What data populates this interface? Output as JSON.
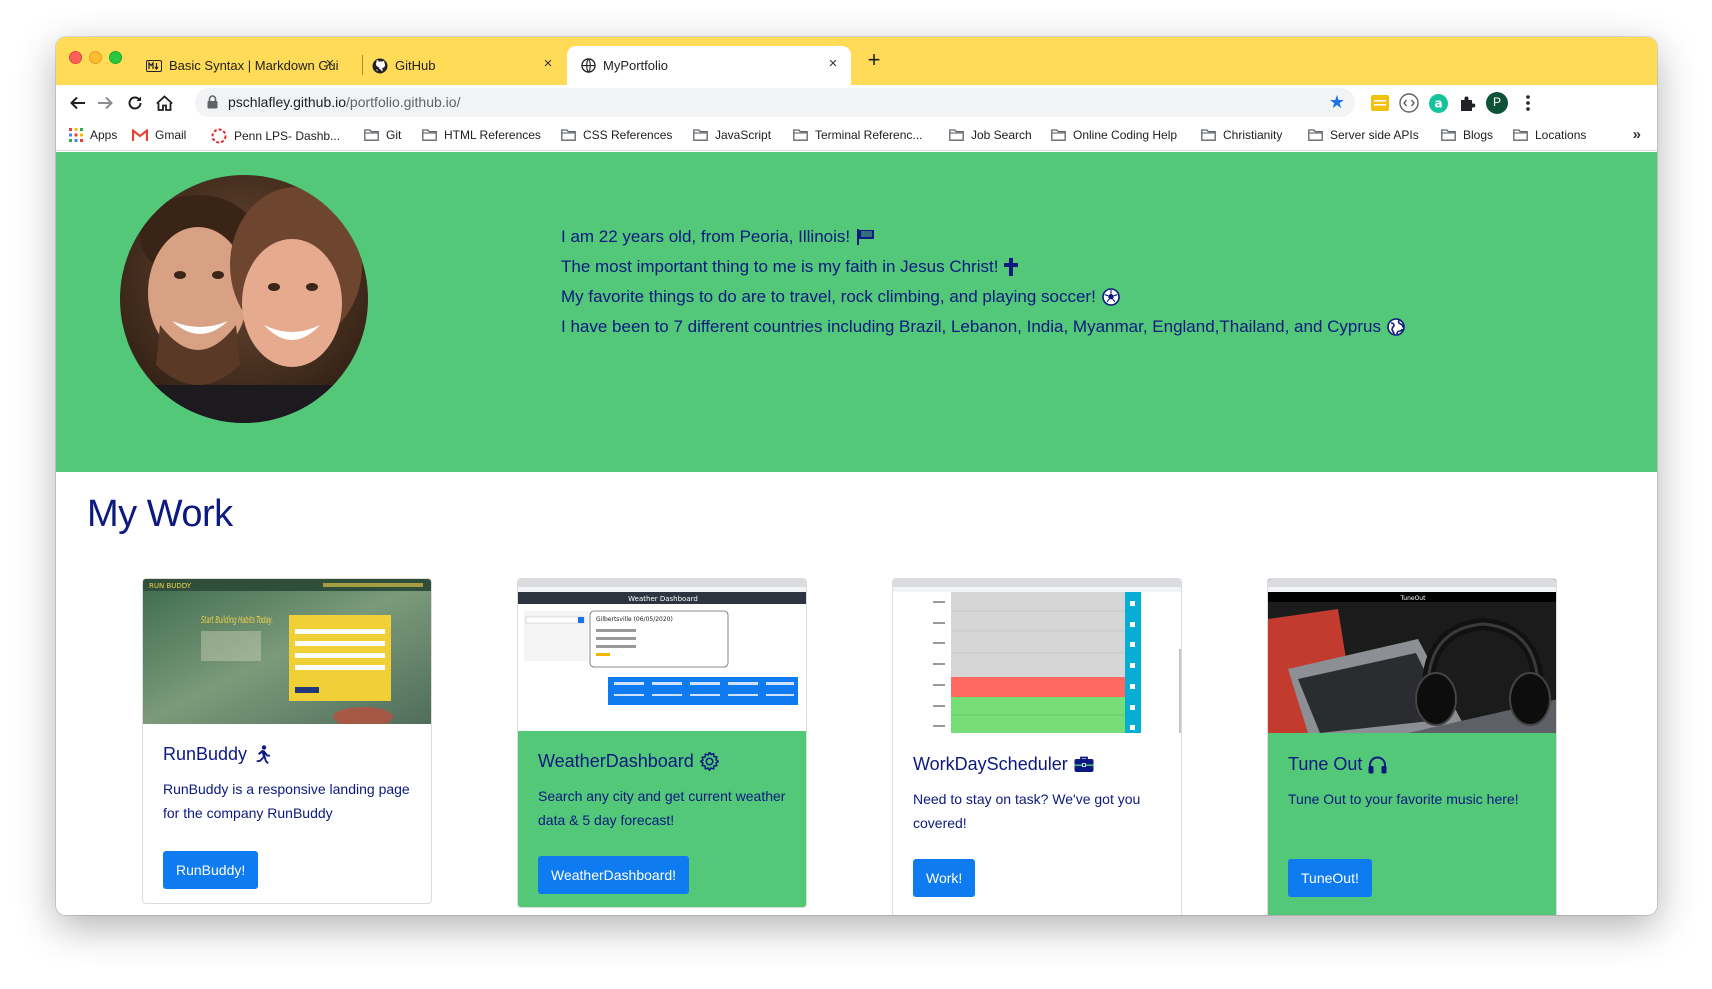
{
  "browser": {
    "tabs": [
      {
        "title": "Basic Syntax | Markdown Guide",
        "favicon": "markdown-icon",
        "active": false
      },
      {
        "title": "GitHub",
        "favicon": "github-icon",
        "active": false
      },
      {
        "title": "MyPortfolio",
        "favicon": "globe-icon",
        "active": true
      }
    ],
    "close_glyph": "×",
    "new_tab_glyph": "+",
    "url_domain": "pschlafley.github.io",
    "url_path": "/portfolio.github.io/",
    "avatar_letter": "P",
    "bookmarks": [
      {
        "label": "Apps",
        "icon": "apps-grid-icon"
      },
      {
        "label": "Gmail",
        "icon": "gmail-icon"
      },
      {
        "label": "Penn LPS- Dashb...",
        "icon": "penn-icon"
      },
      {
        "label": "Git",
        "icon": "folder-icon"
      },
      {
        "label": "HTML References",
        "icon": "folder-icon"
      },
      {
        "label": "CSS References",
        "icon": "folder-icon"
      },
      {
        "label": "JavaScript",
        "icon": "folder-icon"
      },
      {
        "label": "Terminal Referenc...",
        "icon": "folder-icon"
      },
      {
        "label": "Job Search",
        "icon": "folder-icon"
      },
      {
        "label": "Online Coding Help",
        "icon": "folder-icon"
      },
      {
        "label": "Christianity",
        "icon": "folder-icon"
      },
      {
        "label": "Server side APIs",
        "icon": "folder-icon"
      },
      {
        "label": "Blogs",
        "icon": "folder-icon"
      },
      {
        "label": "Locations",
        "icon": "folder-icon"
      }
    ],
    "bookmarks_more": "»"
  },
  "hero": {
    "lines": [
      {
        "text": "I am 22 years old, from Peoria, Illinois!",
        "icon": "flag-icon"
      },
      {
        "text": "The most important thing to me is my faith in Jesus Christ!",
        "icon": "cross-icon"
      },
      {
        "text": "My favorite things to do are to travel, rock climbing, and playing soccer!",
        "icon": "soccer-ball-icon"
      },
      {
        "text": "I have been to 7 different countries including Brazil, Lebanon, India, Myanmar, England,Thailand, and Cyprus",
        "icon": "globe-icon"
      }
    ]
  },
  "work": {
    "title": "My Work",
    "cards": [
      {
        "title": "RunBuddy",
        "icon": "running-icon",
        "text": "RunBuddy is a responsive landing page for the company RunBuddy",
        "button": "RunBuddy!",
        "shot_brand": "RUN BUDDY",
        "shot_heading": "Start Building Habits Today."
      },
      {
        "title": "WeatherDashboard",
        "icon": "gear-icon",
        "text": "Search any city and get current weather data & 5 day forecast!",
        "button": "WeatherDashboard!",
        "shot_heading": "Weather Dashboard",
        "shot_city": "Gilbertsville (06/05/2020)"
      },
      {
        "title": "WorkDayScheduler",
        "icon": "briefcase-icon",
        "text": "Need to stay on task? We've got you covered!",
        "button": "Work!"
      },
      {
        "title": "Tune Out",
        "icon": "headphones-icon",
        "text": "Tune Out to your favorite music here!",
        "button": "TuneOut!",
        "shot_heading": "TuneOut"
      }
    ]
  },
  "colors": {
    "tabstrip": "#ffdb57",
    "hero_bg": "#52c878",
    "text_navy": "#0b1980",
    "button_blue": "#0f7bf0"
  }
}
